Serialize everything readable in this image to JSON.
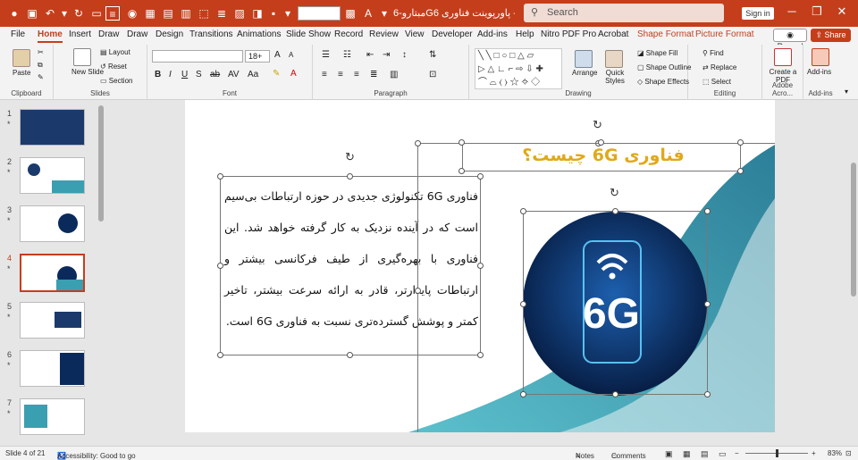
{
  "titlebar": {
    "doc_title": "مبتارو-6Gپاورپوینت فناوری 6  -  PowerP...",
    "search_placeholder": "Search",
    "sign_in": "Sign in",
    "minimize": "─",
    "restore": "❐",
    "close": "✕"
  },
  "menu": {
    "tabs": [
      "File",
      "Home",
      "Insert",
      "Draw",
      "Draw",
      "Design",
      "Transitions",
      "Animations",
      "Slide Show",
      "Record",
      "Review",
      "View",
      "Developer",
      "Add-ins",
      "Help",
      "Nitro PDF Pro",
      "Acrobat",
      "Shape Format",
      "Picture Format"
    ],
    "active": "Home",
    "record": "Record",
    "share": "Share"
  },
  "ribbon": {
    "clipboard": {
      "paste": "Paste",
      "label": "Clipboard"
    },
    "slides": {
      "new_slide": "New Slide",
      "layout": "Layout",
      "reset": "Reset",
      "section": "Section",
      "label": "Slides"
    },
    "font": {
      "size": "18+",
      "label": "Font"
    },
    "paragraph": {
      "label": "Paragraph"
    },
    "drawing": {
      "arrange": "Arrange",
      "quick_styles": "Quick Styles",
      "shape_fill": "Shape Fill",
      "shape_outline": "Shape Outline",
      "shape_effects": "Shape Effects",
      "label": "Drawing"
    },
    "editing": {
      "find": "Find",
      "replace": "Replace",
      "select": "Select",
      "label": "Editing"
    },
    "adobe": {
      "create_pdf": "Create a PDF",
      "label": "Adobe Acro..."
    },
    "addins": {
      "add_ins": "Add-ins",
      "label": "Add-ins"
    }
  },
  "slides_panel": {
    "items": [
      {
        "num": "1",
        "star": "*"
      },
      {
        "num": "2",
        "star": "*"
      },
      {
        "num": "3",
        "star": "*"
      },
      {
        "num": "4",
        "star": "*"
      },
      {
        "num": "5",
        "star": "*"
      },
      {
        "num": "6",
        "star": "*"
      },
      {
        "num": "7",
        "star": "*"
      }
    ],
    "selected": 4
  },
  "slide": {
    "title": "فناوری 6G چیست؟",
    "body": "فناوری 6G تکنولوژی جدیدی در حوزه ارتباطات بی‌سیم است که در آینده نزدیک به کار گرفته خواهد شد. این فناوری با بهره‌گیری از طیف فرکانسی بیشتر و ارتباطات پایدارتر، قادر به ارائه سرعت بیشتر، تاخیر کمتر و پوشش گسترده‌تری نسبت به فناوری 6G است.",
    "image_label": "6G",
    "colors": {
      "teal": "#3a9fb0",
      "gold": "#e0a91a",
      "navy": "#0b2a5c"
    }
  },
  "status": {
    "slide_info": "Slide 4 of 21",
    "accessibility": "Accessibility: Good to go",
    "notes": "Notes",
    "comments": "Comments",
    "zoom": "83%"
  }
}
